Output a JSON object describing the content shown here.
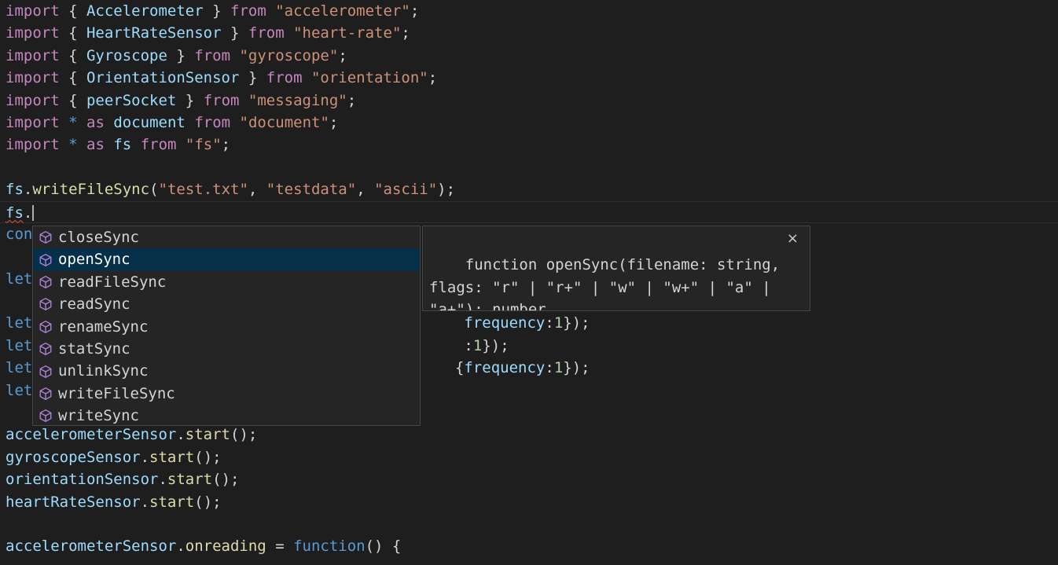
{
  "colors": {
    "keyword": "#c586c0",
    "variable": "#9cdcfe",
    "string": "#ce9178",
    "function": "#dcdcaa",
    "storage": "#569cd6",
    "number": "#b5cea8",
    "punct": "#d4d4d4",
    "text": "#d4d4d4"
  },
  "code": {
    "lines": [
      [
        [
          "import",
          "keyword"
        ],
        [
          " { ",
          "punct"
        ],
        [
          "Accelerometer",
          "variable"
        ],
        [
          " } ",
          "punct"
        ],
        [
          "from",
          "keyword"
        ],
        [
          " ",
          "punct"
        ],
        [
          "\"accelerometer\"",
          "string"
        ],
        [
          ";",
          "punct"
        ]
      ],
      [
        [
          "import",
          "keyword"
        ],
        [
          " { ",
          "punct"
        ],
        [
          "HeartRateSensor",
          "variable"
        ],
        [
          " } ",
          "punct"
        ],
        [
          "from",
          "keyword"
        ],
        [
          " ",
          "punct"
        ],
        [
          "\"heart-rate\"",
          "string"
        ],
        [
          ";",
          "punct"
        ]
      ],
      [
        [
          "import",
          "keyword"
        ],
        [
          " { ",
          "punct"
        ],
        [
          "Gyroscope",
          "variable"
        ],
        [
          " } ",
          "punct"
        ],
        [
          "from",
          "keyword"
        ],
        [
          " ",
          "punct"
        ],
        [
          "\"gyroscope\"",
          "string"
        ],
        [
          ";",
          "punct"
        ]
      ],
      [
        [
          "import",
          "keyword"
        ],
        [
          " { ",
          "punct"
        ],
        [
          "OrientationSensor",
          "variable"
        ],
        [
          " } ",
          "punct"
        ],
        [
          "from",
          "keyword"
        ],
        [
          " ",
          "punct"
        ],
        [
          "\"orientation\"",
          "string"
        ],
        [
          ";",
          "punct"
        ]
      ],
      [
        [
          "import",
          "keyword"
        ],
        [
          " { ",
          "punct"
        ],
        [
          "peerSocket",
          "variable"
        ],
        [
          " } ",
          "punct"
        ],
        [
          "from",
          "keyword"
        ],
        [
          " ",
          "punct"
        ],
        [
          "\"messaging\"",
          "string"
        ],
        [
          ";",
          "punct"
        ]
      ],
      [
        [
          "import",
          "keyword"
        ],
        [
          " ",
          "punct"
        ],
        [
          "*",
          "storage"
        ],
        [
          " ",
          "punct"
        ],
        [
          "as",
          "keyword"
        ],
        [
          " ",
          "punct"
        ],
        [
          "document",
          "variable"
        ],
        [
          " ",
          "punct"
        ],
        [
          "from",
          "keyword"
        ],
        [
          " ",
          "punct"
        ],
        [
          "\"document\"",
          "string"
        ],
        [
          ";",
          "punct"
        ]
      ],
      [
        [
          "import",
          "keyword"
        ],
        [
          " ",
          "punct"
        ],
        [
          "*",
          "storage"
        ],
        [
          " ",
          "punct"
        ],
        [
          "as",
          "keyword"
        ],
        [
          " ",
          "punct"
        ],
        [
          "fs",
          "variable"
        ],
        [
          " ",
          "punct"
        ],
        [
          "from",
          "keyword"
        ],
        [
          " ",
          "punct"
        ],
        [
          "\"fs\"",
          "string"
        ],
        [
          ";",
          "punct"
        ]
      ],
      [],
      [
        [
          "fs",
          "variable"
        ],
        [
          ".",
          "punct"
        ],
        [
          "writeFileSync",
          "function"
        ],
        [
          "(",
          "punct"
        ],
        [
          "\"test.txt\"",
          "string"
        ],
        [
          ", ",
          "punct"
        ],
        [
          "\"testdata\"",
          "string"
        ],
        [
          ", ",
          "punct"
        ],
        [
          "\"ascii\"",
          "string"
        ],
        [
          ");",
          "punct"
        ]
      ],
      [
        [
          "fs",
          "variable",
          "squiggle"
        ],
        [
          ".",
          "punct"
        ]
      ],
      [
        [
          "con",
          "storage"
        ]
      ],
      [],
      [
        [
          "let",
          "storage"
        ]
      ],
      [],
      [
        [
          "let",
          "storage"
        ],
        [
          "                                                ",
          "punct"
        ],
        [
          "frequency",
          "variable"
        ],
        [
          ":",
          "punct"
        ],
        [
          "1",
          "number"
        ],
        [
          "});",
          "punct"
        ]
      ],
      [
        [
          "let",
          "storage"
        ],
        [
          "                                                ",
          "punct"
        ],
        [
          ":",
          "punct"
        ],
        [
          "1",
          "number"
        ],
        [
          "});",
          "punct"
        ]
      ],
      [
        [
          "let",
          "storage"
        ],
        [
          "                                               ",
          "punct"
        ],
        [
          "{",
          "punct"
        ],
        [
          "frequency",
          "variable"
        ],
        [
          ":",
          "punct"
        ],
        [
          "1",
          "number"
        ],
        [
          "});",
          "punct"
        ]
      ],
      [
        [
          "let",
          "storage"
        ]
      ],
      [],
      [
        [
          "accelerometerSensor",
          "variable"
        ],
        [
          ".",
          "punct"
        ],
        [
          "start",
          "function"
        ],
        [
          "();",
          "punct"
        ]
      ],
      [
        [
          "gyroscopeSensor",
          "variable"
        ],
        [
          ".",
          "punct"
        ],
        [
          "start",
          "function"
        ],
        [
          "();",
          "punct"
        ]
      ],
      [
        [
          "orientationSensor",
          "variable"
        ],
        [
          ".",
          "punct"
        ],
        [
          "start",
          "function"
        ],
        [
          "();",
          "punct"
        ]
      ],
      [
        [
          "heartRateSensor",
          "variable"
        ],
        [
          ".",
          "punct"
        ],
        [
          "start",
          "function"
        ],
        [
          "();",
          "punct"
        ]
      ],
      [],
      [
        [
          "accelerometerSensor",
          "variable"
        ],
        [
          ".",
          "punct"
        ],
        [
          "onreading",
          "function"
        ],
        [
          " = ",
          "punct"
        ],
        [
          "function",
          "storage"
        ],
        [
          "() {",
          "punct"
        ]
      ]
    ]
  },
  "suggest": {
    "items": [
      {
        "label": "closeSync",
        "icon": "method-cube-icon"
      },
      {
        "label": "openSync",
        "icon": "method-cube-icon"
      },
      {
        "label": "readFileSync",
        "icon": "method-cube-icon"
      },
      {
        "label": "readSync",
        "icon": "method-cube-icon"
      },
      {
        "label": "renameSync",
        "icon": "method-cube-icon"
      },
      {
        "label": "statSync",
        "icon": "method-cube-icon"
      },
      {
        "label": "unlinkSync",
        "icon": "method-cube-icon"
      },
      {
        "label": "writeFileSync",
        "icon": "method-cube-icon"
      },
      {
        "label": "writeSync",
        "icon": "method-cube-icon"
      }
    ],
    "selected_index": 1,
    "icon_color": "#b180d7"
  },
  "details": {
    "signature": "function openSync(filename: string, flags: \"r\" | \"r+\" | \"w\" | \"w+\" | \"a\" | \"a+\"): number",
    "close_symbol": "×"
  }
}
